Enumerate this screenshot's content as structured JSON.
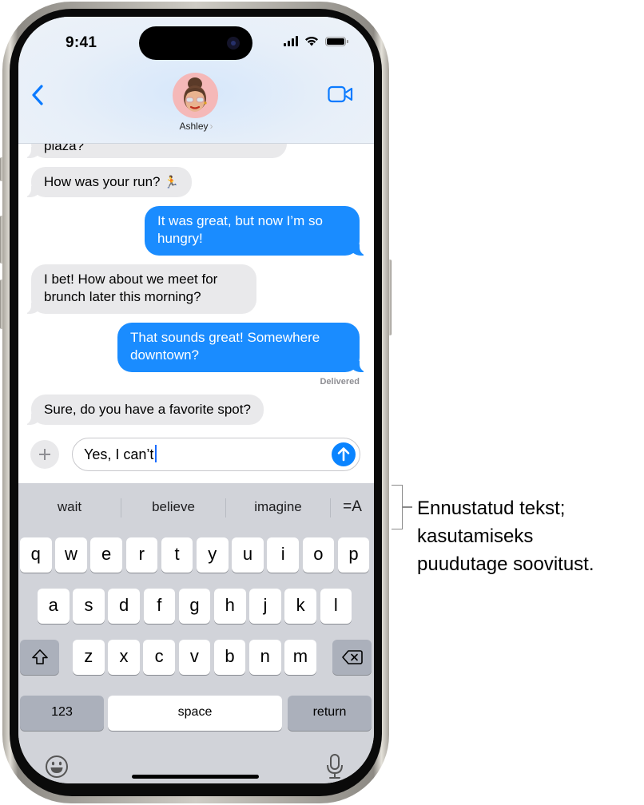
{
  "status_bar": {
    "time": "9:41",
    "signal_icon": "cellular-signal-icon",
    "wifi_icon": "wifi-icon",
    "battery_icon": "battery-full-icon"
  },
  "header": {
    "back_icon": "chevron-left-icon",
    "contact_name": "Ashley",
    "contact_chevron": "›",
    "avatar": "memoji-avatar",
    "video_icon": "video-camera-icon",
    "accent_color": "#0a7aff"
  },
  "messages": [
    {
      "direction": "in",
      "text": "plaza?"
    },
    {
      "direction": "in",
      "text": "How was your run? 🏃"
    },
    {
      "direction": "out",
      "text": "It was great, but now I’m so hungry!"
    },
    {
      "direction": "in",
      "text": "I bet! How about we meet for brunch later this morning?"
    },
    {
      "direction": "out",
      "text": "That sounds great! Somewhere downtown?"
    },
    {
      "direction": "in",
      "text": "Sure, do you have a favorite spot?"
    }
  ],
  "message_lines": {
    "m0": "plaza?",
    "m1": "How was your run? ",
    "m1_emoji": "🏃",
    "m2_l1": "It was great, but now I’m so",
    "m2_l2": "hungry!",
    "m3_l1": "I bet! How about we meet for",
    "m3_l2": "brunch later this morning?",
    "m4_l1": "That sounds great! Somewhere",
    "m4_l2": "downtown?",
    "m5": "Sure, do you have a favorite spot?"
  },
  "delivered_label": "Delivered",
  "composer": {
    "plus_icon": "plus-icon",
    "input_value": "Yes, I can’t",
    "send_icon": "arrow-up-icon",
    "send_color": "#0a84ff"
  },
  "keyboard": {
    "suggestions": [
      "wait",
      "believe",
      "imagine"
    ],
    "writing_tools_icon": "text-format-icon",
    "writing_tools_glyph": "=A",
    "row1": [
      "q",
      "w",
      "e",
      "r",
      "t",
      "y",
      "u",
      "i",
      "o",
      "p"
    ],
    "row2": [
      "a",
      "s",
      "d",
      "f",
      "g",
      "h",
      "j",
      "k",
      "l"
    ],
    "row3": [
      "z",
      "x",
      "c",
      "v",
      "b",
      "n",
      "m"
    ],
    "shift_icon": "shift-icon",
    "delete_icon": "delete-backward-icon",
    "numbers_label": "123",
    "space_label": "space",
    "return_label": "return",
    "emoji_icon": "emoji-icon",
    "mic_icon": "microphone-icon"
  },
  "annotation": {
    "lines": [
      "Ennustatud tekst;",
      "kasutamiseks",
      "puudutage soovitust."
    ]
  }
}
